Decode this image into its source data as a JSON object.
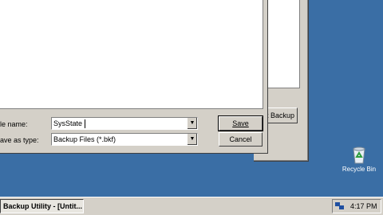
{
  "dialog": {
    "file_name_label": "le name:",
    "file_name_value": "SysState",
    "save_as_type_label": "ave as type:",
    "save_as_type_value": "Backup Files (*.bkf)",
    "save_label": "Save",
    "cancel_label": "Cancel"
  },
  "background_window": {
    "start_backup_label": "t Backup"
  },
  "desktop": {
    "recycle_bin_label": "Recycle Bin"
  },
  "taskbar": {
    "task_label": "Backup Utility - [Untit...",
    "clock": "4:17 PM"
  },
  "colors": {
    "desktop": "#3a6ea5",
    "face": "#d4d0c8"
  }
}
